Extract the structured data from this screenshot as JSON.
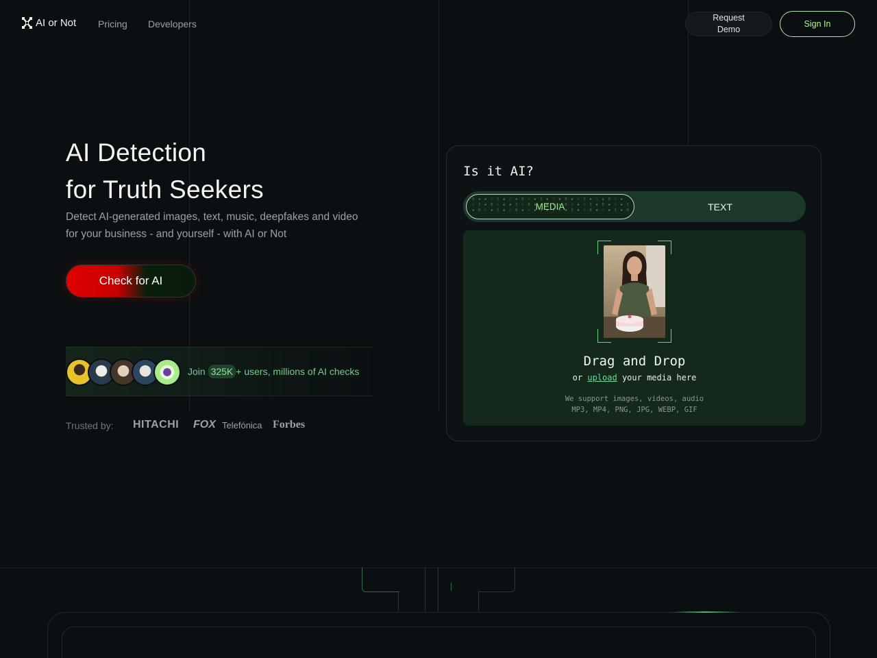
{
  "nav": {
    "logo_text": "AI or Not",
    "links": [
      "Pricing",
      "Developers"
    ],
    "request_demo": [
      "Request",
      "Demo"
    ],
    "sign_in": "Sign In"
  },
  "hero": {
    "title_line1": "AI Detection",
    "title_line2": "for Truth Seekers",
    "subtitle": "Detect AI-generated images, text, music, deepfakes and video for your business - and yourself - with AI or Not",
    "cta": "Check for AI",
    "social_prefix": "Join ",
    "social_count": "325K",
    "social_suffix": "+ users, millions of AI checks",
    "trusted_label": "Trusted by:",
    "brands": [
      "HITACHI",
      "FOX",
      "Telefónica",
      "Forbes"
    ]
  },
  "card": {
    "title": "Is it AI?",
    "tabs": {
      "media": "MEDIA",
      "text": "TEXT",
      "active": "MEDIA"
    },
    "drop_title": "Drag and Drop",
    "drop_or": "or ",
    "drop_upload": "upload",
    "drop_suffix": " your media here",
    "support_line1": "We support images, videos, audio",
    "support_line2": "MP3, MP4, PNG, JPG, WEBP, GIF"
  },
  "colors": {
    "background": "#0b0f12",
    "accent_green": "#9ef07c",
    "cta_red": "#e00000"
  }
}
